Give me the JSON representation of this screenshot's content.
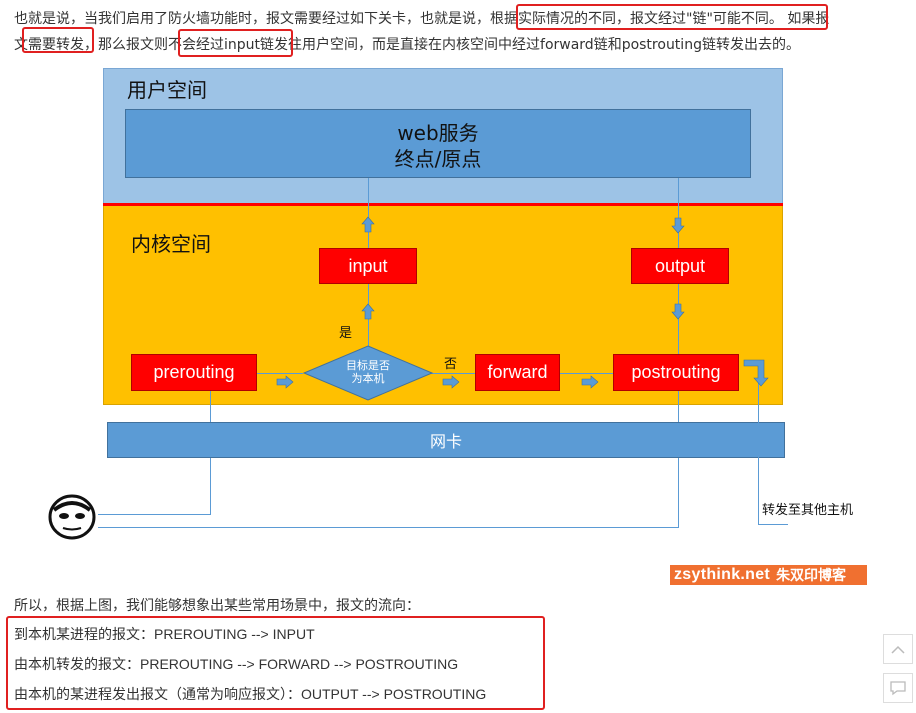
{
  "intro": {
    "line1_a": "也就是说，当我们启用了防火墙功能时，报文需要经过如下关卡，也就是说，",
    "line1_b": "根据实际情况的不同，报文经过\"链\"可能不同。",
    "line1_c": "如果报",
    "line2_a": "文",
    "line2_b": "需要转发",
    "line2_c": "，那么报文则",
    "line2_d": "不会经过input链",
    "line2_e": "发往用户空间，而是直接在内核空间中经过forward链和postrouting链转发出去的。"
  },
  "diagram": {
    "user_space_label": "用户空间",
    "web_service_line1": "web服务",
    "web_service_line2": "终点/原点",
    "kernel_space_label": "内核空间",
    "input_label": "input",
    "output_label": "output",
    "prerouting_label": "prerouting",
    "decision_line1": "目标是否",
    "decision_line2": "为本机",
    "yes_label": "是",
    "no_label": "否",
    "forward_label": "forward",
    "postrouting_label": "postrouting",
    "nic_label": "网卡",
    "forward_to_other_label": "转发至其他主机"
  },
  "watermark": {
    "site": "zsythink.net",
    "name": "朱双印博客"
  },
  "summary": {
    "intro": "所以，根据上图，我们能够想象出某些常用场景中，报文的流向：",
    "flows": [
      "到本机某进程的报文：PREROUTING --> INPUT",
      "由本机转发的报文：PREROUTING --> FORWARD --> POSTROUTING",
      "由本机的某进程发出报文（通常为响应报文）：OUTPUT --> POSTROUTING"
    ]
  },
  "controls": {
    "scroll_top_icon": "chevron-up-icon",
    "comment_icon": "comment-icon"
  },
  "colors": {
    "user_space": "#9dc3e6",
    "web_service": "#5b9bd5",
    "kernel_space": "#ffc000",
    "chain_box": "#ff0000",
    "decision": "#5b9bd5",
    "nic": "#5b9bd5",
    "highlight": "#e02020"
  }
}
